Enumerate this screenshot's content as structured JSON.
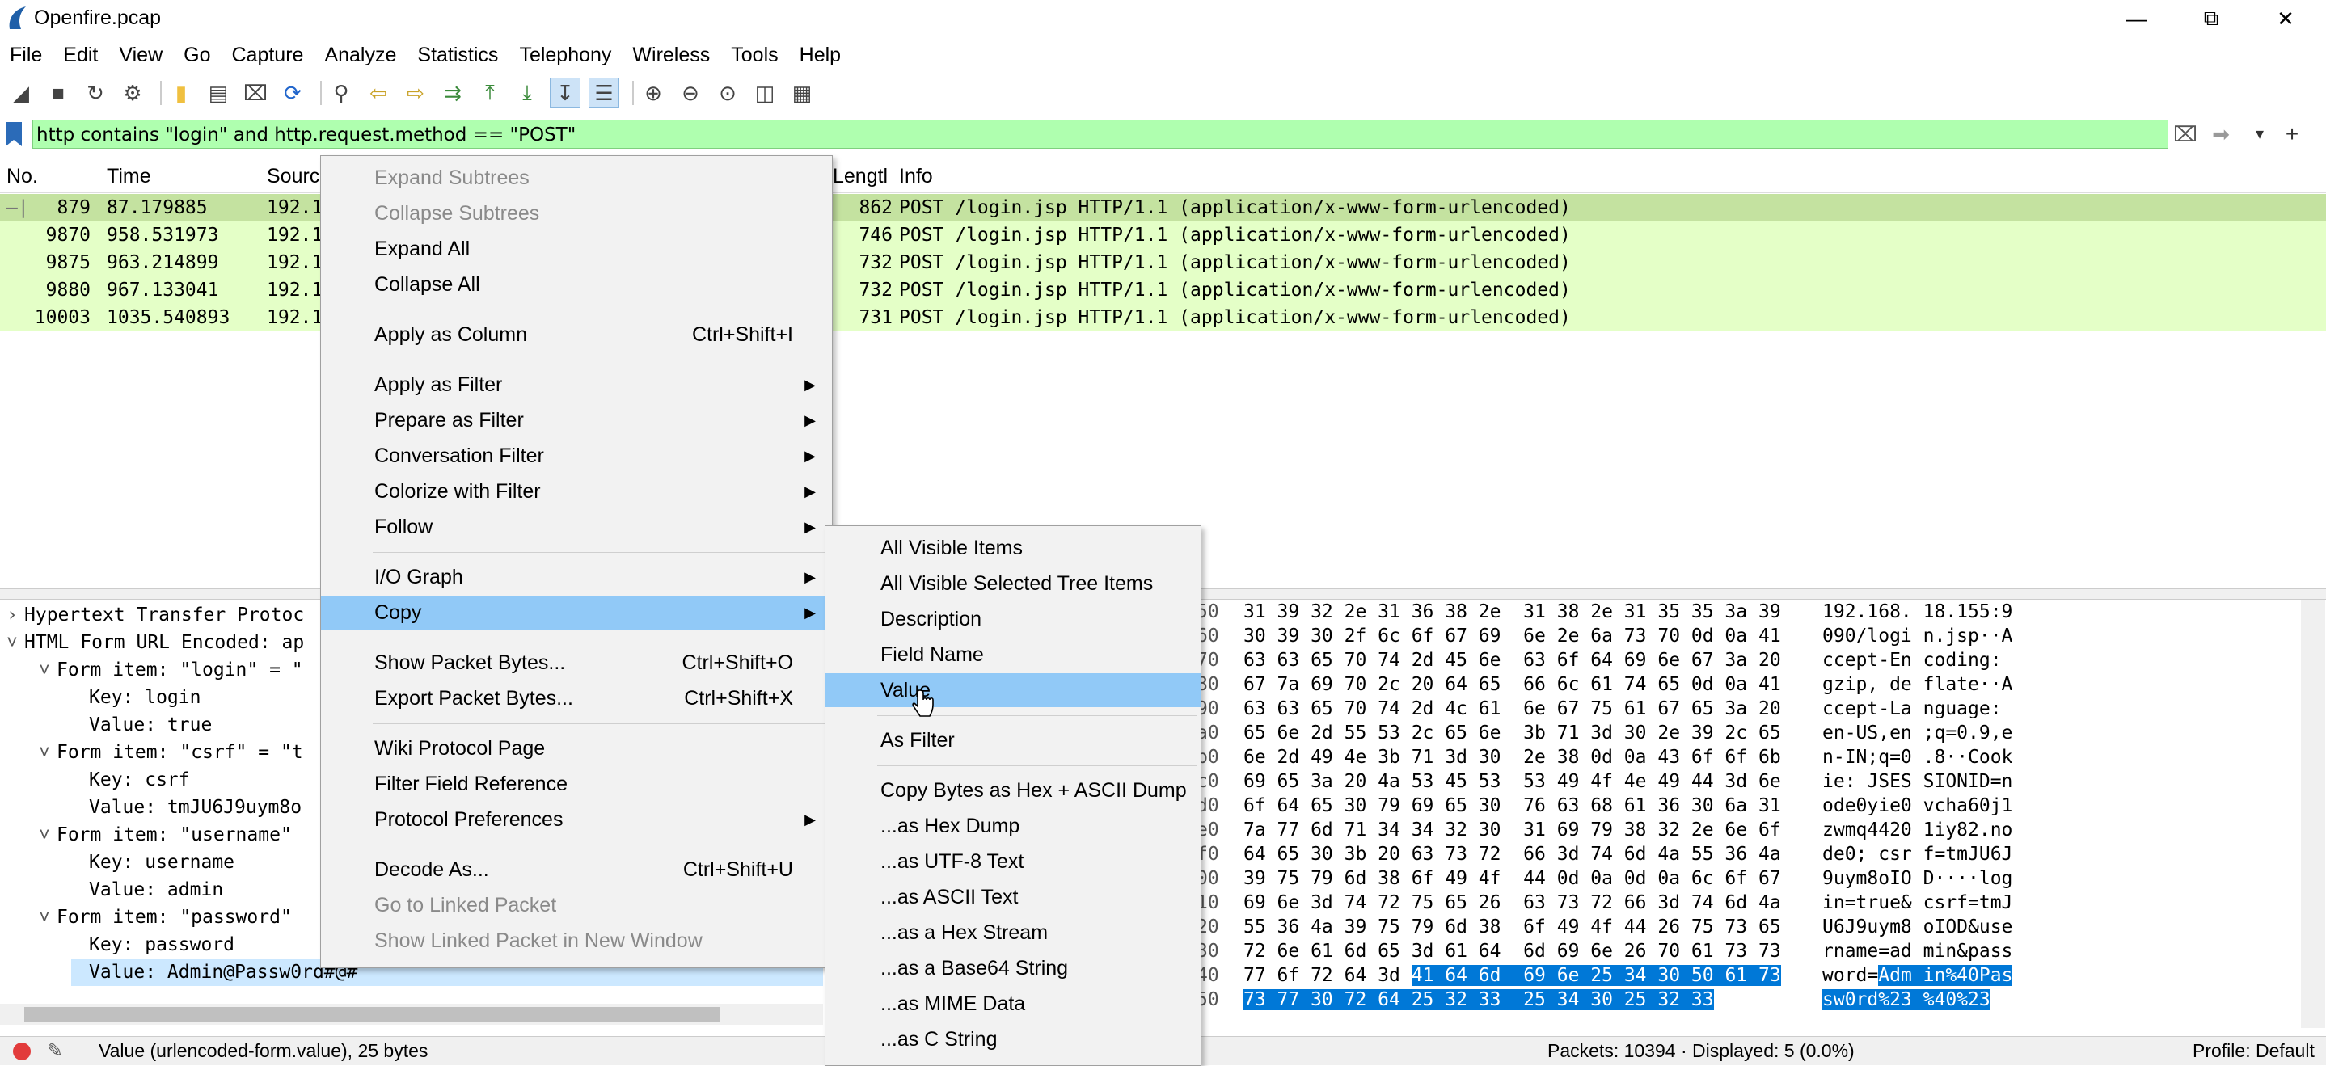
{
  "window": {
    "title": "Openfire.pcap",
    "min_icon": "minimize-icon",
    "max_icon": "restore-icon",
    "close_icon": "close-icon"
  },
  "menubar": [
    "File",
    "Edit",
    "View",
    "Go",
    "Capture",
    "Analyze",
    "Statistics",
    "Telephony",
    "Wireless",
    "Tools",
    "Help"
  ],
  "filter": {
    "value": "http contains \"login\" and http.request.method == \"POST\""
  },
  "packet_list": {
    "columns": {
      "no": "No.",
      "time": "Time",
      "source": "Sourc",
      "length": "Lengtl",
      "info": "Info"
    },
    "rows": [
      {
        "no": "879",
        "time": "87.179885",
        "src": "192.1",
        "len": "862",
        "info": "POST /login.jsp HTTP/1.1  (application/x-www-form-urlencoded)"
      },
      {
        "no": "9870",
        "time": "958.531973",
        "src": "192.1",
        "len": "746",
        "info": "POST /login.jsp HTTP/1.1  (application/x-www-form-urlencoded)"
      },
      {
        "no": "9875",
        "time": "963.214899",
        "src": "192.1",
        "len": "732",
        "info": "POST /login.jsp HTTP/1.1  (application/x-www-form-urlencoded)"
      },
      {
        "no": "9880",
        "time": "967.133041",
        "src": "192.1",
        "len": "732",
        "info": "POST /login.jsp HTTP/1.1  (application/x-www-form-urlencoded)"
      },
      {
        "no": "10003",
        "time": "1035.540893",
        "src": "192.1",
        "len": "731",
        "info": "POST /login.jsp HTTP/1.1  (application/x-www-form-urlencoded)"
      }
    ]
  },
  "tree": [
    {
      "text": "Hypertext Transfer Protoc",
      "indent": 0,
      "chev": "›"
    },
    {
      "text": "HTML Form URL Encoded: ap",
      "indent": 0,
      "chev": "˅"
    },
    {
      "text": "Form item: \"login\" = \"",
      "indent": 1,
      "chev": "˅"
    },
    {
      "text": "Key: login",
      "indent": 2,
      "chev": ""
    },
    {
      "text": "Value: true",
      "indent": 2,
      "chev": ""
    },
    {
      "text": "Form item: \"csrf\" = \"t",
      "indent": 1,
      "chev": "˅"
    },
    {
      "text": "Key: csrf",
      "indent": 2,
      "chev": ""
    },
    {
      "text": "Value: tmJU6J9uym8o",
      "indent": 2,
      "chev": ""
    },
    {
      "text": "Form item: \"username\"",
      "indent": 1,
      "chev": "˅"
    },
    {
      "text": "Key: username",
      "indent": 2,
      "chev": ""
    },
    {
      "text": "Value: admin",
      "indent": 2,
      "chev": ""
    },
    {
      "text": "Form item: \"password\"",
      "indent": 1,
      "chev": "˅"
    },
    {
      "text": "Key: password",
      "indent": 2,
      "chev": ""
    },
    {
      "text": "Value: Admin@Passw0rd#@#",
      "indent": 2,
      "chev": "",
      "selected": true
    }
  ],
  "hex": [
    {
      "off": "50",
      "bytes": "31 39 32 2e 31 36 38 2e  31 38 2e 31 35 35 3a 39",
      "ascii": "192.168. 18.155:9"
    },
    {
      "off": "60",
      "bytes": "30 39 30 2f 6c 6f 67 69  6e 2e 6a 73 70 0d 0a 41",
      "ascii": "090/logi n.jsp··A"
    },
    {
      "off": "70",
      "bytes": "63 63 65 70 74 2d 45 6e  63 6f 64 69 6e 67 3a 20",
      "ascii": "ccept-En coding: "
    },
    {
      "off": "80",
      "bytes": "67 7a 69 70 2c 20 64 65  66 6c 61 74 65 0d 0a 41",
      "ascii": "gzip, de flate··A"
    },
    {
      "off": "90",
      "bytes": "63 63 65 70 74 2d 4c 61  6e 67 75 61 67 65 3a 20",
      "ascii": "ccept-La nguage: "
    },
    {
      "off": "a0",
      "bytes": "65 6e 2d 55 53 2c 65 6e  3b 71 3d 30 2e 39 2c 65",
      "ascii": "en-US,en ;q=0.9,e"
    },
    {
      "off": "b0",
      "bytes": "6e 2d 49 4e 3b 71 3d 30  2e 38 0d 0a 43 6f 6f 6b",
      "ascii": "n-IN;q=0 .8··Cook"
    },
    {
      "off": "c0",
      "bytes": "69 65 3a 20 4a 53 45 53  53 49 4f 4e 49 44 3d 6e",
      "ascii": "ie: JSES SIONID=n"
    },
    {
      "off": "d0",
      "bytes": "6f 64 65 30 79 69 65 30  76 63 68 61 36 30 6a 31",
      "ascii": "ode0yie0 vcha60j1"
    },
    {
      "off": "e0",
      "bytes": "7a 77 6d 71 34 34 32 30  31 69 79 38 32 2e 6e 6f",
      "ascii": "zwmq4420 1iy82.no"
    },
    {
      "off": "f0",
      "bytes": "64 65 30 3b 20 63 73 72  66 3d 74 6d 4a 55 36 4a",
      "ascii": "de0; csr f=tmJU6J"
    },
    {
      "off": "00",
      "bytes": "39 75 79 6d 38 6f 49 4f  44 0d 0a 0d 0a 6c 6f 67",
      "ascii": "9uym8oIO D····log"
    },
    {
      "off": "10",
      "bytes": "69 6e 3d 74 72 75 65 26  63 73 72 66 3d 74 6d 4a",
      "ascii": "in=true& csrf=tmJ"
    },
    {
      "off": "20",
      "bytes": "55 36 4a 39 75 79 6d 38  6f 49 4f 44 26 75 73 65",
      "ascii": "U6J9uym8 oIOD&use"
    },
    {
      "off": "30",
      "bytes": "72 6e 61 6d 65 3d 61 64  6d 69 6e 26 70 61 73 73",
      "ascii": "rname=ad min&pass"
    },
    {
      "off": "40",
      "bytes": "77 6f 72 64 3d ",
      "bytes_hl": "41 64 6d  69 6e 25 34 30 50 61 73",
      "ascii": "word=",
      "ascii_hl": "Adm in%40Pas"
    },
    {
      "off": "50",
      "bytes": "",
      "bytes_hl": "73 77 30 72 64 25 32 33  25 34 30 25 32 33",
      "ascii": "",
      "ascii_hl": "sw0rd%23 %40%23"
    }
  ],
  "status": {
    "field": "Value (urlencoded-form.value), 25 bytes",
    "packets": "Packets: 10394 · Displayed: 5 (0.0%)",
    "profile": "Profile: Default"
  },
  "context_menu": [
    {
      "label": "Expand Subtrees",
      "disabled": true
    },
    {
      "label": "Collapse Subtrees",
      "disabled": true
    },
    {
      "label": "Expand All"
    },
    {
      "label": "Collapse All"
    },
    {
      "sep": true
    },
    {
      "label": "Apply as Column",
      "shortcut": "Ctrl+Shift+I"
    },
    {
      "sep": true
    },
    {
      "label": "Apply as Filter",
      "submenu": true
    },
    {
      "label": "Prepare as Filter",
      "submenu": true
    },
    {
      "label": "Conversation Filter",
      "submenu": true
    },
    {
      "label": "Colorize with Filter",
      "submenu": true
    },
    {
      "label": "Follow",
      "submenu": true
    },
    {
      "sep": true
    },
    {
      "label": "I/O Graph",
      "submenu": true
    },
    {
      "label": "Copy",
      "submenu": true,
      "hover": true
    },
    {
      "sep": true
    },
    {
      "label": "Show Packet Bytes...",
      "shortcut": "Ctrl+Shift+O"
    },
    {
      "label": "Export Packet Bytes...",
      "shortcut": "Ctrl+Shift+X"
    },
    {
      "sep": true
    },
    {
      "label": "Wiki Protocol Page"
    },
    {
      "label": "Filter Field Reference"
    },
    {
      "label": "Protocol Preferences",
      "submenu": true
    },
    {
      "sep": true
    },
    {
      "label": "Decode As...",
      "shortcut": "Ctrl+Shift+U"
    },
    {
      "label": "Go to Linked Packet",
      "disabled": true
    },
    {
      "label": "Show Linked Packet in New Window",
      "disabled": true
    }
  ],
  "copy_submenu": [
    {
      "label": "All Visible Items"
    },
    {
      "label": "All Visible Selected Tree Items"
    },
    {
      "label": "Description"
    },
    {
      "label": "Field Name"
    },
    {
      "label": "Value",
      "hover": true
    },
    {
      "sep": true
    },
    {
      "label": "As Filter"
    },
    {
      "sep": true
    },
    {
      "label": "Copy Bytes as Hex + ASCII Dump"
    },
    {
      "label": "...as Hex Dump"
    },
    {
      "label": "...as UTF-8 Text"
    },
    {
      "label": "...as ASCII Text"
    },
    {
      "label": "...as a Hex Stream"
    },
    {
      "label": "...as a Base64 String"
    },
    {
      "label": "...as MIME Data"
    },
    {
      "label": "...as C String"
    }
  ]
}
